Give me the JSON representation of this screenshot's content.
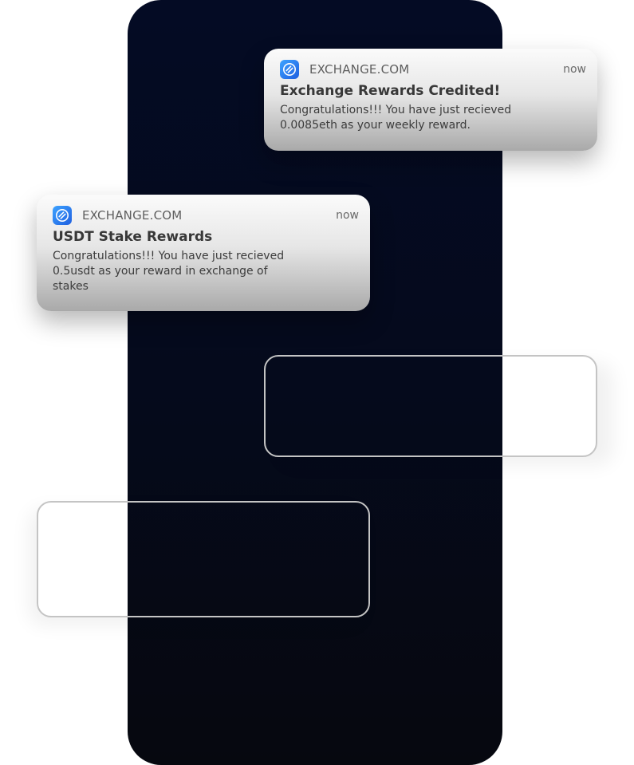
{
  "notifications": [
    {
      "app_name": "EXCHANGE.COM",
      "time": "now",
      "title": "Exchange Rewards Credited!",
      "body": "Congratulations!!! You have just recieved 0.0085eth as your weekly reward."
    },
    {
      "app_name": "EXCHANGE.COM",
      "time": "now",
      "title": "USDT Stake Rewards",
      "body": "Congratulations!!! You have just recieved 0.5usdt as your reward in exchange of stakes"
    }
  ],
  "colors": {
    "phone_background": "#040b24",
    "app_icon": "#2f7cf0"
  },
  "icons": {
    "app": "exchange-logo-icon"
  }
}
